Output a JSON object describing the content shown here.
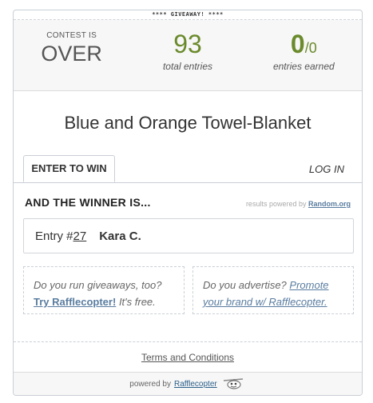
{
  "banner": "**** GIVEAWAY! ****",
  "stats": {
    "status_label": "CONTEST IS",
    "status_value": "OVER",
    "total_entries": "93",
    "total_entries_label": "total entries",
    "earned": "0",
    "earned_total": "/0",
    "earned_label": "entries earned"
  },
  "giveaway_title": "Blue and Orange Towel-Blanket",
  "tabs": {
    "enter": "ENTER TO WIN",
    "login": "LOG IN"
  },
  "winner": {
    "heading": "AND THE WINNER IS...",
    "powered_prefix": "results powered by",
    "powered_link": "Random.org",
    "entry_prefix": "Entry #",
    "entry_number": "27",
    "entry_name": "Kara C."
  },
  "promos": {
    "left_text": "Do you run giveaways, too?",
    "left_link": "Try Rafflecopter!",
    "left_suffix": "It's free.",
    "right_text": "Do you advertise?",
    "right_link": "Promote your brand w/ Rafflecopter."
  },
  "terms": "Terms and Conditions",
  "footer": {
    "prefix": "powered by",
    "link": "Rafflecopter",
    "logo_icon": "rafflecopter-logo-icon"
  }
}
